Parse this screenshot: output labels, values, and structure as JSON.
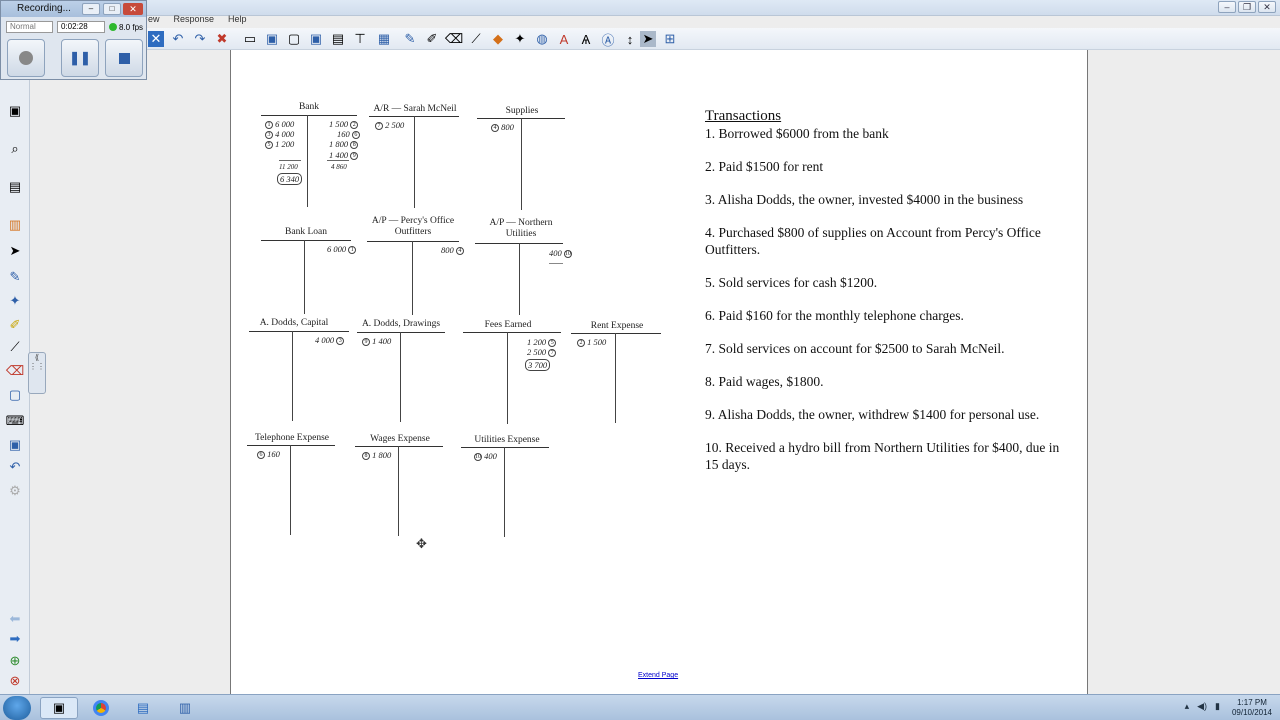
{
  "recorder": {
    "title": "Recording...",
    "mode": "Normal",
    "time": "0:02:28",
    "fps": "8.0 fps",
    "min_label": "–",
    "max_label": "□",
    "close_label": "✕"
  },
  "menu": {
    "items": [
      "ew",
      "Response",
      "Help"
    ]
  },
  "window_controls": {
    "minimize": "–",
    "restore": "❐",
    "close": "✕"
  },
  "accounts": [
    {
      "title": "Bank",
      "left": [
        [
          "1",
          "6 000"
        ],
        [
          "3",
          "4 000"
        ],
        [
          "5",
          "1 200"
        ]
      ],
      "right": [
        [
          "1 500",
          "2"
        ],
        [
          "160",
          "6"
        ],
        [
          "1 800",
          "8"
        ],
        [
          "1 400",
          "9"
        ]
      ],
      "left_total": "11 200",
      "right_total": "4 860",
      "balance": "6 340"
    },
    {
      "title": "A/R — Sarah McNeil",
      "left": [
        [
          "7",
          "2 500"
        ]
      ]
    },
    {
      "title": "Supplies",
      "left": [
        [
          "4",
          "800"
        ]
      ]
    },
    {
      "title": "Bank Loan",
      "right": [
        [
          "6 000",
          "1"
        ]
      ]
    },
    {
      "title": "A/P — Percy's Office Outfitters",
      "right": [
        [
          "800",
          "4"
        ]
      ]
    },
    {
      "title": "A/P — Northern Utilities",
      "right": [
        [
          "400",
          "10"
        ]
      ]
    },
    {
      "title": "A. Dodds, Capital",
      "right": [
        [
          "4 000",
          "3"
        ]
      ]
    },
    {
      "title": "A. Dodds, Drawings",
      "left": [
        [
          "9",
          "1 400"
        ]
      ]
    },
    {
      "title": "Fees Earned",
      "right": [
        [
          "1 200",
          "5"
        ],
        [
          "2 500",
          "7"
        ]
      ],
      "balance": "3 700"
    },
    {
      "title": "Rent Expense",
      "left": [
        [
          "2",
          "1 500"
        ]
      ]
    },
    {
      "title": "Telephone Expense",
      "left": [
        [
          "6",
          "160"
        ]
      ]
    },
    {
      "title": "Wages Expense",
      "left": [
        [
          "8",
          "1 800"
        ]
      ]
    },
    {
      "title": "Utilities Expense",
      "left": [
        [
          "10",
          "400"
        ]
      ]
    }
  ],
  "transactions": {
    "heading": "Transactions",
    "items": [
      "1. Borrowed $6000 from the bank",
      "2. Paid $1500 for rent",
      "3. Alisha Dodds, the owner, invested $4000 in the business",
      "4. Purchased $800 of supplies on Account from Percy's Office Outfitters.",
      "5. Sold services for cash $1200.",
      "6. Paid $160 for the monthly telephone charges.",
      "7. Sold services on account for $2500 to Sarah McNeil.",
      "8. Paid wages, $1800.",
      "9. Alisha Dodds, the owner, withdrew $1400 for personal use.",
      "10. Received a hydro bill from Northern Utilities for $400, due in 15 days."
    ]
  },
  "extend_page": "Extend Page",
  "clock": {
    "time": "1:17 PM",
    "date": "09/10/2014"
  }
}
